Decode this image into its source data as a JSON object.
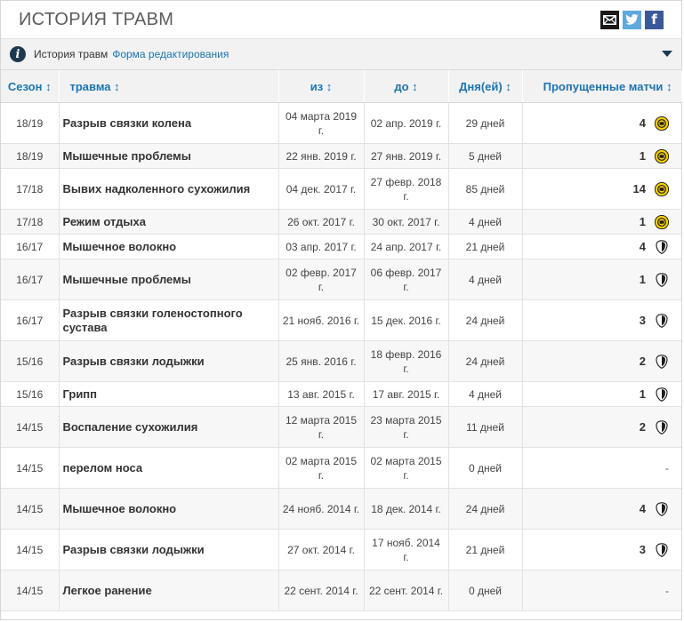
{
  "header": {
    "title": "ИСТОРИЯ ТРАВМ"
  },
  "share": {
    "icons": [
      "mail-icon",
      "twitter-icon",
      "facebook-icon"
    ],
    "facebook_glyph": "f"
  },
  "info": {
    "label": "История травм",
    "link": "Форма редактирования"
  },
  "columns": {
    "season": "Сезон ↕",
    "injury": "травма ↕",
    "from": "из ↕",
    "to": "до ↕",
    "days": "Дня(ей) ↕",
    "games": "Пропущенные матчи ↕"
  },
  "colors": {
    "accent": "#1d75b3",
    "header_bg": "#f2f2f2",
    "bvb_yellow": "#f5d000",
    "dark": "#1d3950"
  },
  "rows": [
    {
      "season": "18/19",
      "injury": "Разрыв связки колена",
      "from": "04 марта 2019 г.",
      "to": "02 апр. 2019 г.",
      "days": "29 дней",
      "games": "4",
      "club": "bvb"
    },
    {
      "season": "18/19",
      "injury": "Мышечные проблемы",
      "from": "22 янв. 2019 г.",
      "to": "27 янв. 2019 г.",
      "days": "5 дней",
      "games": "1",
      "club": "bvb"
    },
    {
      "season": "17/18",
      "injury": "Вывих надколенного сухожилия",
      "from": "04 дек. 2017 г.",
      "to": "27 февр. 2018 г.",
      "days": "85 дней",
      "games": "14",
      "club": "bvb"
    },
    {
      "season": "17/18",
      "injury": "Режим отдыха",
      "from": "26 окт. 2017 г.",
      "to": "30 окт. 2017 г.",
      "days": "4 дней",
      "games": "1",
      "club": "bvb"
    },
    {
      "season": "16/17",
      "injury": "Мышечное волокно",
      "from": "03 апр. 2017 г.",
      "to": "24 апр. 2017 г.",
      "days": "21 дней",
      "games": "4",
      "club": "freiburg"
    },
    {
      "season": "16/17",
      "injury": "Мышечные проблемы",
      "from": "02 февр. 2017 г.",
      "to": "06 февр. 2017 г.",
      "days": "4 дней",
      "games": "1",
      "club": "freiburg"
    },
    {
      "season": "16/17",
      "injury": "Разрыв связки голеностопного сустава",
      "from": "21 нояб. 2016 г.",
      "to": "15 дек. 2016 г.",
      "days": "24 дней",
      "games": "3",
      "club": "freiburg"
    },
    {
      "season": "15/16",
      "injury": "Разрыв связки лодыжки",
      "from": "25 янв. 2016 г.",
      "to": "18 февр. 2016 г.",
      "days": "24 дней",
      "games": "2",
      "club": "freiburg"
    },
    {
      "season": "15/16",
      "injury": "Грипп",
      "from": "13 авг. 2015 г.",
      "to": "17 авг. 2015 г.",
      "days": "4 дней",
      "games": "1",
      "club": "freiburg"
    },
    {
      "season": "14/15",
      "injury": "Воспаление сухожилия",
      "from": "12 марта 2015 г.",
      "to": "23 марта 2015 г.",
      "days": "11 дней",
      "games": "2",
      "club": "freiburg"
    },
    {
      "season": "14/15",
      "injury": "перелом носа",
      "from": "02 марта 2015 г.",
      "to": "02 марта 2015 г.",
      "days": "0 дней",
      "games": "-",
      "club": ""
    },
    {
      "season": "14/15",
      "injury": "Мышечное волокно",
      "from": "24 нояб. 2014 г.",
      "to": "18 дек. 2014 г.",
      "days": "24 дней",
      "games": "4",
      "club": "freiburg"
    },
    {
      "season": "14/15",
      "injury": "Разрыв связки лодыжки",
      "from": "27 окт. 2014 г.",
      "to": "17 нояб. 2014 г.",
      "days": "21 дней",
      "games": "3",
      "club": "freiburg"
    },
    {
      "season": "14/15",
      "injury": "Легкое ранение",
      "from": "22 сент. 2014 г.",
      "to": "22 сент. 2014 г.",
      "days": "0 дней",
      "games": "-",
      "club": ""
    }
  ]
}
